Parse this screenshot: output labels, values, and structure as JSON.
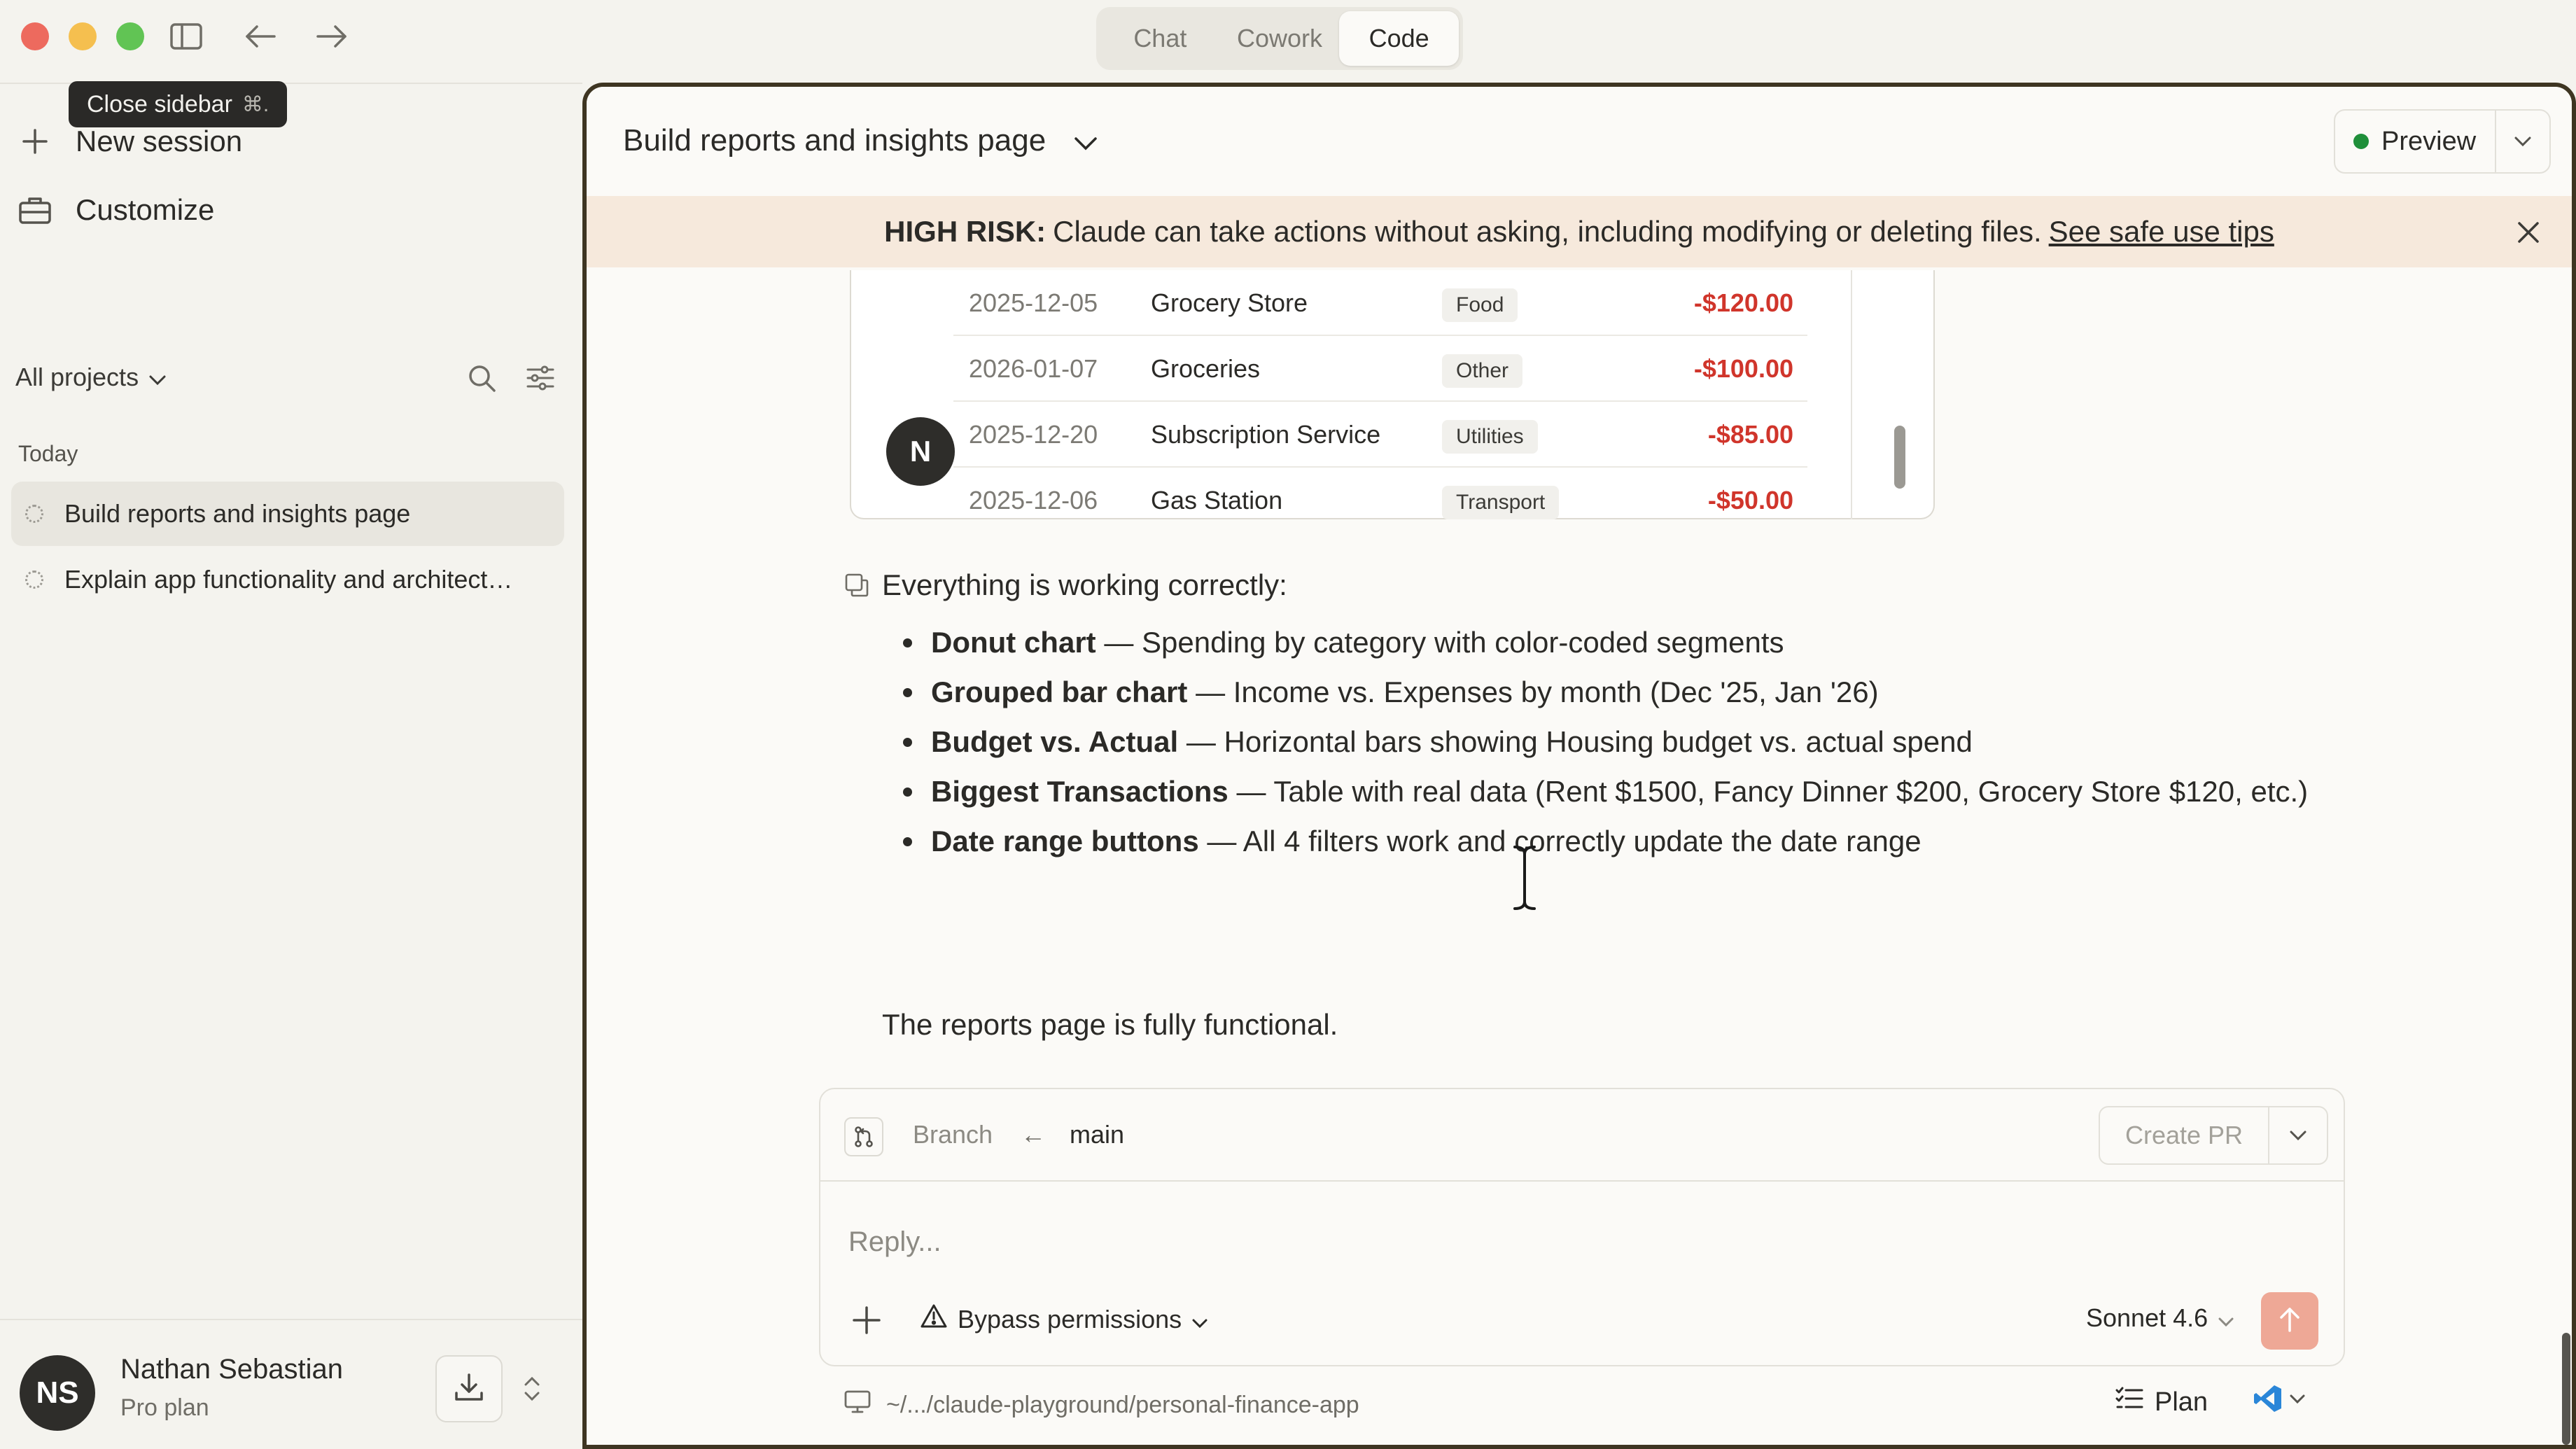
{
  "window": {
    "modes": [
      "Chat",
      "Cowork",
      "Code"
    ],
    "active_mode": "Code"
  },
  "tooltip": {
    "text": "Close sidebar",
    "shortcut": "⌘."
  },
  "sidebar": {
    "new_session": "New session",
    "customize": "Customize",
    "project_filter": "All projects",
    "section": "Today",
    "sessions": [
      {
        "title": "Build reports and insights page",
        "active": true
      },
      {
        "title": "Explain app functionality and architect…",
        "active": false
      }
    ],
    "user": {
      "initials": "NS",
      "name": "Nathan Sebastian",
      "plan": "Pro plan"
    }
  },
  "main": {
    "title": "Build reports and insights page",
    "preview_label": "Preview",
    "banner": {
      "risk_label": "HIGH RISK:",
      "message": "Claude can take actions without asking, including modifying or deleting files.",
      "link": "See safe use tips"
    },
    "badge": "N",
    "transactions": [
      {
        "date": "2025-12-05",
        "desc": "Grocery Store",
        "category": "Food",
        "amount": "-$120.00"
      },
      {
        "date": "2026-01-07",
        "desc": "Groceries",
        "category": "Other",
        "amount": "-$100.00"
      },
      {
        "date": "2025-12-20",
        "desc": "Subscription Service",
        "category": "Utilities",
        "amount": "-$85.00"
      },
      {
        "date": "2025-12-06",
        "desc": "Gas Station",
        "category": "Transport",
        "amount": "-$50.00"
      }
    ],
    "message": {
      "intro": "Everything is working correctly:",
      "bullets": [
        {
          "title": "Donut chart",
          "text": " — Spending by category with color-coded segments"
        },
        {
          "title": "Grouped bar chart",
          "text": " — Income vs. Expenses by month (Dec '25, Jan '26)"
        },
        {
          "title": "Budget vs. Actual",
          "text": " — Horizontal bars showing Housing budget vs. actual spend"
        },
        {
          "title": "Biggest Transactions",
          "text": " — Table with real data (Rent $1500, Fancy Dinner $200, Grocery Store $120, etc.)"
        },
        {
          "title": "Date range buttons",
          "text": " — All 4 filters work and correctly update the date range"
        }
      ],
      "outro": "The reports page is fully functional."
    },
    "composer": {
      "branch_label": "Branch",
      "branch_arrow": "←",
      "branch_name": "main",
      "create_pr": "Create PR",
      "reply_placeholder": "Reply...",
      "permissions": "Bypass permissions",
      "model": "Sonnet 4.6"
    },
    "path": "~/.../claude-playground/personal-finance-app",
    "plan_label": "Plan"
  },
  "colors": {
    "accent_send": "#eea896",
    "negative_amount": "#d0352b",
    "preview_dot": "#1f8f3a",
    "banner_bg": "#f6e9dc"
  },
  "icons": [
    "sidebar-toggle-icon",
    "back-arrow-icon",
    "forward-arrow-icon",
    "plus-icon",
    "toolbox-icon",
    "search-icon",
    "filter-icon",
    "download-icon",
    "chevron-down-icon",
    "close-icon",
    "copy-icon",
    "branch-icon",
    "warning-icon",
    "send-arrow-icon",
    "monitor-icon",
    "plan-list-icon",
    "vscode-icon"
  ]
}
